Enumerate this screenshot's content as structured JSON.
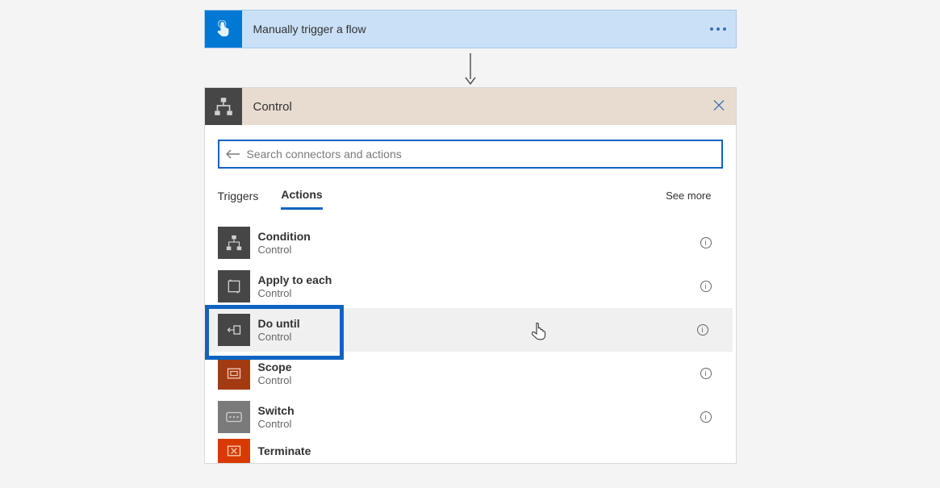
{
  "trigger": {
    "title": "Manually trigger a flow"
  },
  "connector": {
    "title": "Control"
  },
  "search": {
    "placeholder": "Search connectors and actions"
  },
  "tabs": {
    "triggers": "Triggers",
    "actions": "Actions",
    "see_more": "See more"
  },
  "action_sub": "Control",
  "actions": [
    {
      "name": "Condition",
      "icon": "condition-icon",
      "bg": ""
    },
    {
      "name": "Apply to each",
      "icon": "apply-to-each-icon",
      "bg": ""
    },
    {
      "name": "Do until",
      "icon": "do-until-icon",
      "bg": ""
    },
    {
      "name": "Scope",
      "icon": "scope-icon",
      "bg": "scope-bg"
    },
    {
      "name": "Switch",
      "icon": "switch-icon",
      "bg": "switch-bg"
    },
    {
      "name": "Terminate",
      "icon": "terminate-icon",
      "bg": "terminate-bg"
    }
  ]
}
